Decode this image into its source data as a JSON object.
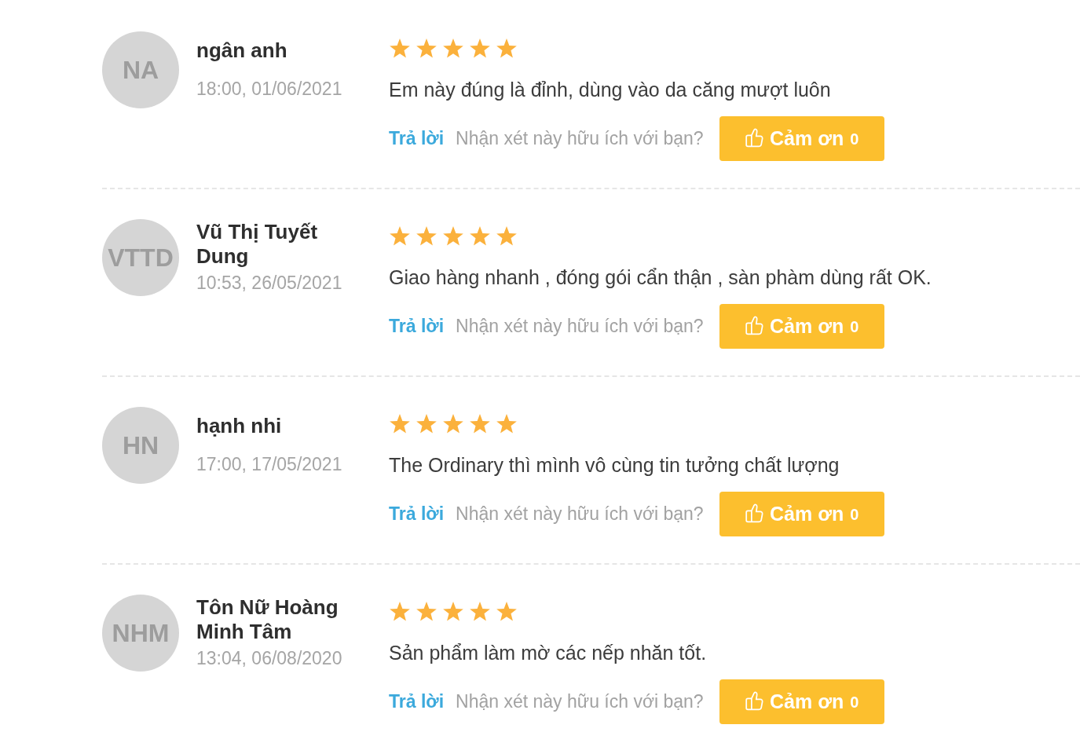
{
  "reviews": [
    {
      "avatar_initials": "NA",
      "name": "ngân anh",
      "date": "18:00, 01/06/2021",
      "stars": 5,
      "text": "Em này đúng là đỉnh, dùng vào da căng mượt luôn",
      "reply_link": "Trả lời",
      "helpful_prompt": "Nhận xét này hữu ích với bạn?",
      "thanks_button": {
        "label": "Cảm ơn",
        "count": "0"
      }
    },
    {
      "avatar_initials": "VTTD",
      "name": "Vũ Thị Tuyết Dung",
      "date": "10:53, 26/05/2021",
      "stars": 5,
      "text": "Giao hàng nhanh , đóng gói cẩn thận , sàn phàm dùng rất OK.",
      "reply_link": "Trả lời",
      "helpful_prompt": "Nhận xét này hữu ích với bạn?",
      "thanks_button": {
        "label": "Cảm ơn",
        "count": "0"
      }
    },
    {
      "avatar_initials": "HN",
      "name": "hạnh nhi",
      "date": "17:00, 17/05/2021",
      "stars": 5,
      "text": "The Ordinary thì mình vô cùng tin tưởng chất lượng",
      "reply_link": "Trả lời",
      "helpful_prompt": "Nhận xét này hữu ích với bạn?",
      "thanks_button": {
        "label": "Cảm ơn",
        "count": "0"
      }
    },
    {
      "avatar_initials": "NHM",
      "name": "Tôn Nữ Hoàng Minh Tâm",
      "date": "13:04, 06/08/2020",
      "stars": 5,
      "text": "Sản phẩm làm mờ các nếp nhăn tốt.",
      "reply_link": "Trả lời",
      "helpful_prompt": "Nhận xét này hữu ích với bạn?",
      "thanks_button": {
        "label": "Cảm ơn",
        "count": "0"
      }
    }
  ]
}
